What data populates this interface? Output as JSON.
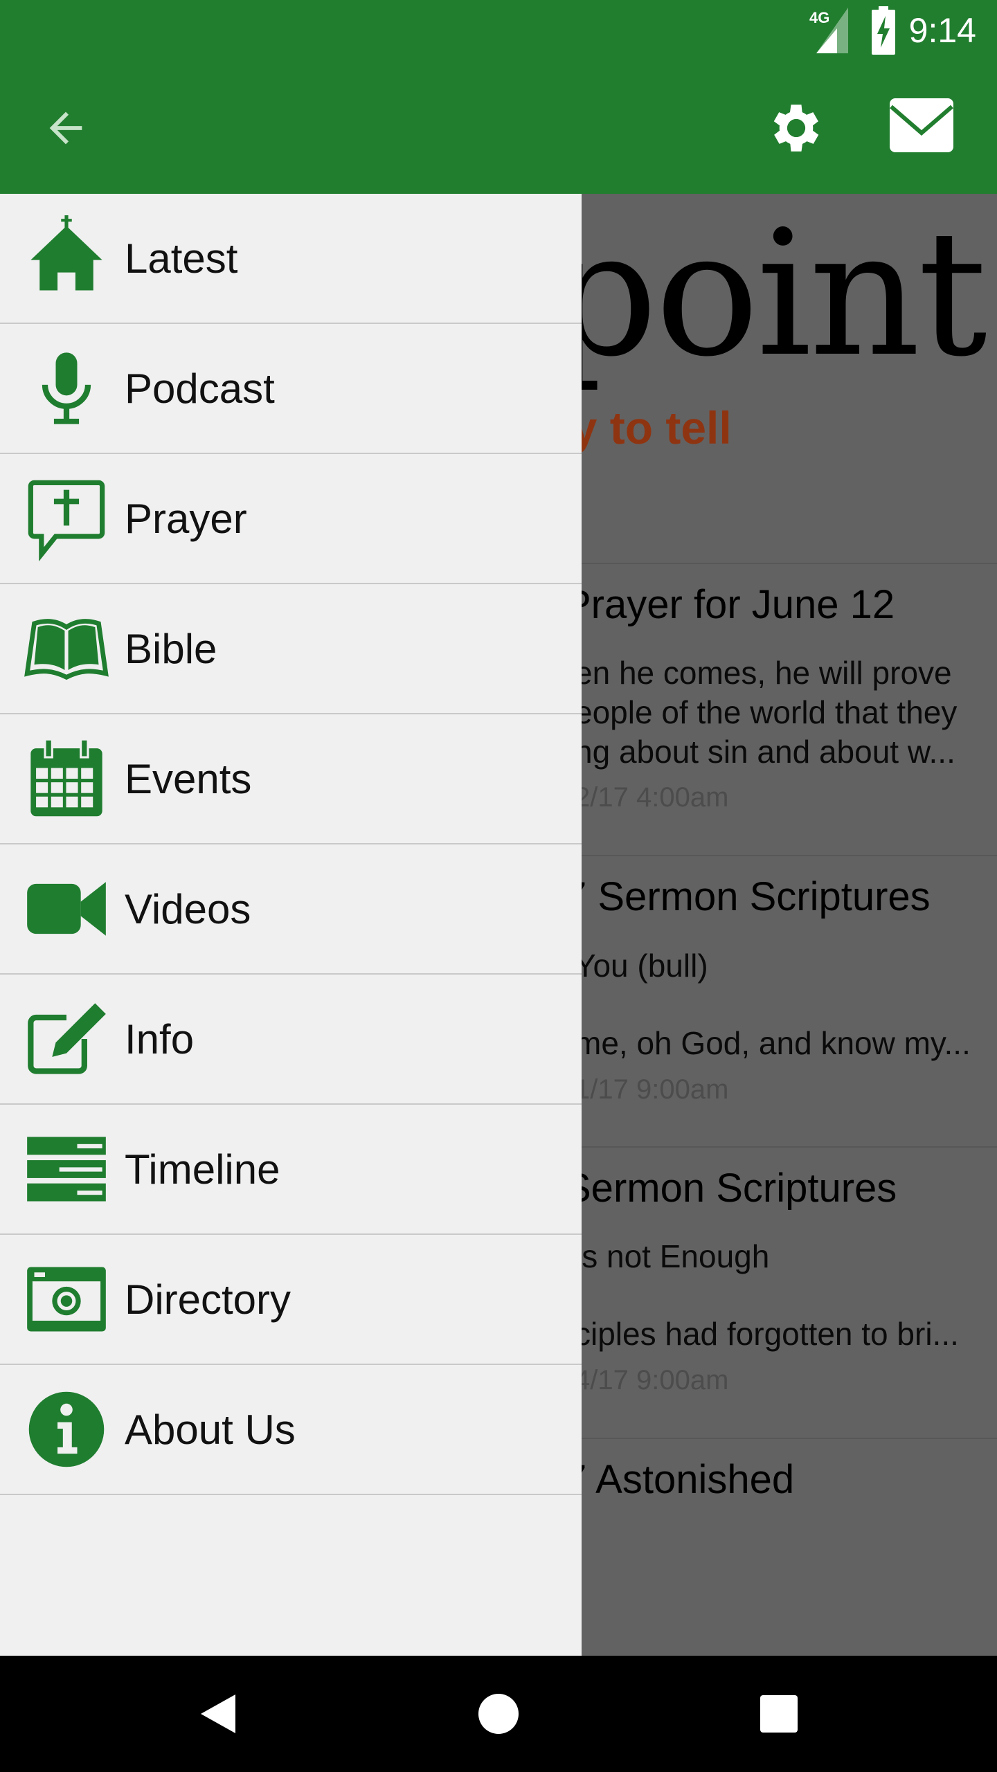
{
  "status_bar": {
    "network": "4G",
    "time": "9:14"
  },
  "toolbar": {
    "back_icon": "arrow-left-icon",
    "settings_icon": "gear-icon",
    "mail_icon": "envelope-icon"
  },
  "colors": {
    "primary": "#217e2f",
    "drawer_bg": "#f0f0f0",
    "icon": "#1f7d2f",
    "scrim": "#626262",
    "tagline": "#8f3411"
  },
  "content": {
    "logo_text": "point",
    "tagline": "ry to tell",
    "items": [
      {
        "title": "Prayer for June 12",
        "lines": [
          "en he comes, he will prove",
          "eople of the world that they",
          "ng about sin and about w..."
        ],
        "date": "2/17 4:00am"
      },
      {
        "title": "7 Sermon Scriptures",
        "lines": [
          "You (bull)",
          "me, oh God, and know my..."
        ],
        "date": "1/17 9:00am"
      },
      {
        "title": "Sermon Scriptures",
        "lines": [
          "is not Enough",
          "ciples had forgotten to bri..."
        ],
        "date": "4/17 9:00am"
      },
      {
        "title": "7 Astonished"
      }
    ]
  },
  "drawer": {
    "items": [
      {
        "label": "Latest",
        "icon": "church-icon"
      },
      {
        "label": "Podcast",
        "icon": "microphone-icon"
      },
      {
        "label": "Prayer",
        "icon": "prayer-bubble-icon"
      },
      {
        "label": "Bible",
        "icon": "open-book-icon"
      },
      {
        "label": "Events",
        "icon": "calendar-icon"
      },
      {
        "label": "Videos",
        "icon": "video-camera-icon"
      },
      {
        "label": "Info",
        "icon": "edit-icon"
      },
      {
        "label": "Timeline",
        "icon": "timeline-icon"
      },
      {
        "label": "Directory",
        "icon": "camera-icon"
      },
      {
        "label": "About Us",
        "icon": "info-icon"
      }
    ]
  },
  "nav_bar": {
    "back": "back-triangle-icon",
    "home": "home-circle-icon",
    "recents": "recents-square-icon"
  }
}
